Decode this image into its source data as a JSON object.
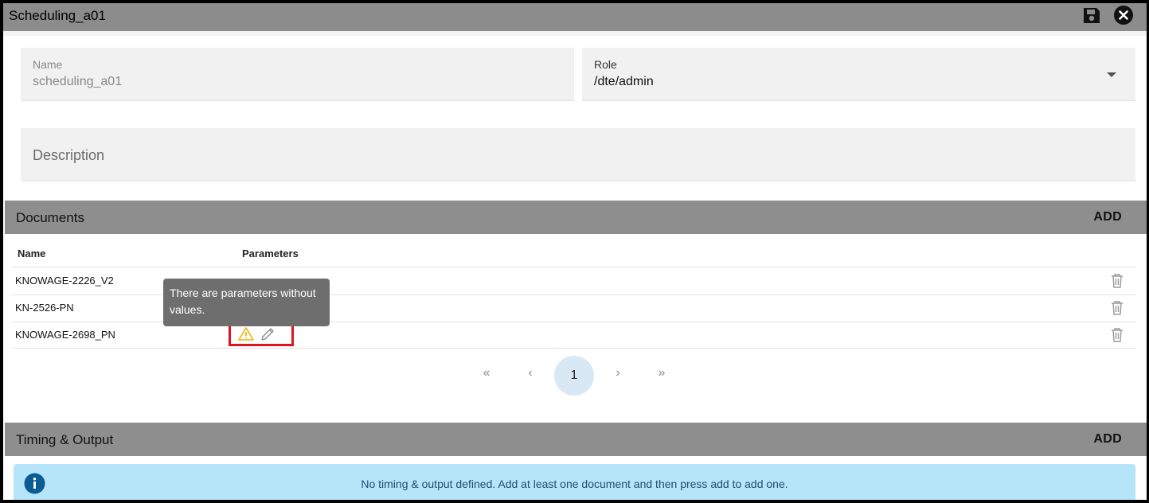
{
  "window": {
    "title": "Scheduling_a01",
    "save_icon": "floppy-disk-icon",
    "close_icon": "close-circle-icon"
  },
  "form": {
    "name_label": "Name",
    "name_value": "scheduling_a01",
    "role_label": "Role",
    "role_value": "/dte/admin",
    "description_placeholder": "Description"
  },
  "documents": {
    "title": "Documents",
    "add_label": "ADD",
    "columns": [
      "Name",
      "Parameters"
    ],
    "rows": [
      {
        "name": "KNOWAGE-2226_V2"
      },
      {
        "name": "KN-2526-PN"
      },
      {
        "name": "KNOWAGE-2698_PN",
        "warning_icon": "warning-triangle-icon",
        "edit_icon": "pencil-icon"
      }
    ],
    "tooltip": "There are parameters without values.",
    "pagination": {
      "first": "«",
      "prev": "‹",
      "current": "1",
      "next": "›",
      "last": "»"
    }
  },
  "timing": {
    "title": "Timing & Output",
    "add_label": "ADD",
    "info_message": "No timing & output defined. Add at least one document and then press add to add one."
  },
  "colors": {
    "header_gray": "#8e8e8e",
    "warning": "#f0b400",
    "highlight": "#e0141e",
    "info_bg": "#b6e4f8",
    "info_icon": "#0b5c93"
  }
}
